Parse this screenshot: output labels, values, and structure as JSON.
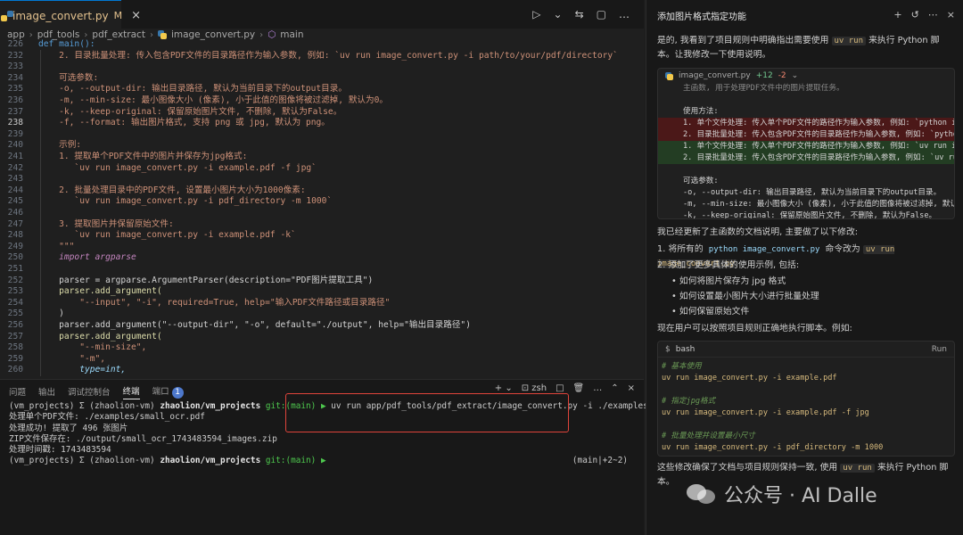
{
  "editor": {
    "tab": {
      "label": "image_convert.py",
      "modified": "M",
      "close": "×"
    },
    "actions": [
      "▷",
      "⌄",
      "⇆",
      "▢",
      "…"
    ],
    "breadcrumb": [
      "app",
      "pdf_tools",
      "pdf_extract",
      "image_convert.py",
      "main"
    ],
    "lines": [
      {
        "n": "226",
        "text": "def main():",
        "kind": "def"
      },
      {
        "n": "232",
        "text": "    2. 目录批量处理: 传入包含PDF文件的目录路径作为输入参数, 例如: `uv run image_convert.py -i path/to/your/pdf/directory`",
        "kind": "doc"
      },
      {
        "n": "233",
        "text": "",
        "kind": "doc"
      },
      {
        "n": "234",
        "text": "    可选参数:",
        "kind": "doc"
      },
      {
        "n": "235",
        "text": "    -o, --output-dir: 输出目录路径, 默认为当前目录下的output目录。",
        "kind": "doc"
      },
      {
        "n": "236",
        "text": "    -m, --min-size: 最小图像大小 (像素), 小于此值的图像将被过滤掉, 默认为0。",
        "kind": "doc"
      },
      {
        "n": "237",
        "text": "    -k, --keep-original: 保留原始图片文件, 不删除, 默认为False。",
        "kind": "doc"
      },
      {
        "n": "238",
        "text": "    -f, --format: 输出图片格式, 支持 png 或 jpg, 默认为 png。",
        "kind": "doc",
        "active": true
      },
      {
        "n": "239",
        "text": "",
        "kind": "doc"
      },
      {
        "n": "240",
        "text": "    示例:",
        "kind": "doc"
      },
      {
        "n": "241",
        "text": "    1. 提取单个PDF文件中的图片并保存为jpg格式:",
        "kind": "doc"
      },
      {
        "n": "242",
        "text": "       `uv run image_convert.py -i example.pdf -f jpg`",
        "kind": "doc"
      },
      {
        "n": "243",
        "text": "",
        "kind": "doc"
      },
      {
        "n": "244",
        "text": "    2. 批量处理目录中的PDF文件, 设置最小图片大小为1000像素:",
        "kind": "doc"
      },
      {
        "n": "245",
        "text": "       `uv run image_convert.py -i pdf_directory -m 1000`",
        "kind": "doc"
      },
      {
        "n": "246",
        "text": "",
        "kind": "doc"
      },
      {
        "n": "247",
        "text": "    3. 提取图片并保留原始文件:",
        "kind": "doc"
      },
      {
        "n": "248",
        "text": "       `uv run image_convert.py -i example.pdf -k`",
        "kind": "doc"
      },
      {
        "n": "249",
        "text": "    \"\"\"",
        "kind": "doc"
      },
      {
        "n": "250",
        "text": "    import argparse",
        "kind": "import"
      },
      {
        "n": "251",
        "text": "",
        "kind": "plain"
      },
      {
        "n": "252",
        "text": "    parser = argparse.ArgumentParser(description=\"PDF图片提取工具\")",
        "kind": "parser"
      },
      {
        "n": "253",
        "text": "    parser.add_argument(",
        "kind": "call"
      },
      {
        "n": "254",
        "text": "        \"--input\", \"-i\", required=True, help=\"输入PDF文件路径或目录路径\"",
        "kind": "args1"
      },
      {
        "n": "255",
        "text": "    )",
        "kind": "plain"
      },
      {
        "n": "256",
        "text": "    parser.add_argument(\"--output-dir\", \"-o\", default=\"./output\", help=\"输出目录路径\")",
        "kind": "args2"
      },
      {
        "n": "257",
        "text": "    parser.add_argument(",
        "kind": "call"
      },
      {
        "n": "258",
        "text": "        \"--min-size\",",
        "kind": "strline"
      },
      {
        "n": "259",
        "text": "        \"-m\",",
        "kind": "strline"
      },
      {
        "n": "260",
        "text": "        type=int,",
        "kind": "typeline"
      }
    ]
  },
  "panel": {
    "tabs": [
      "问题",
      "输出",
      "调试控制台",
      "终端",
      "端口"
    ],
    "active_tab": "终端",
    "port_badge": "1",
    "actions": [
      "+ ⌄",
      "zsh",
      "□",
      "🗑",
      "…",
      "⌃",
      "×"
    ],
    "terminal": [
      {
        "prompt": "(vm_projects) Σ (zhaolion-vm) ",
        "path": "zhaolion/vm_projects",
        "git": " git:(main) ▶ ",
        "cmd": "uv run app/pdf_tools/pdf_extract/image_convert.py -i ./examples/small_ocr.pdf"
      },
      {
        "out": "处理单个PDF文件: ./examples/small_ocr.pdf"
      },
      {
        "out": "处理成功! 提取了 496 张图片"
      },
      {
        "out": "ZIP文件保存在: ./output/small_ocr_1743483594_images.zip"
      },
      {
        "out": "处理时间戳: 1743483594"
      },
      {
        "prompt": "(vm_projects) Σ (zhaolion-vm) ",
        "path": "zhaolion/vm_projects",
        "git": " git:(main) ▶ ",
        "cmd": "",
        "right": "(main|+2~2)"
      }
    ]
  },
  "chat": {
    "title": "添加图片格式指定功能",
    "header_actions": [
      "+",
      "↺",
      "⋯",
      "×"
    ],
    "intro_a": "是的, 我看到了项目规则中明确指出需要使用",
    "intro_chip": "uv run",
    "intro_b": "来执行 Python 脚本。让我修改一下使用说明。",
    "diff": {
      "file": "image_convert.py",
      "plus": "+12",
      "minus": "-2",
      "lines": [
        {
          "type": "faded",
          "text": "主函数, 用于处理PDF文件中的图片提取任务。"
        },
        {
          "type": "ctx",
          "text": ""
        },
        {
          "type": "ctx",
          "text": "使用方法:"
        },
        {
          "type": "del",
          "text": "1. 单个文件处理: 传入单个PDF文件的路径作为输入参数, 例如: `python image"
        },
        {
          "type": "del",
          "text": "2. 目录批量处理: 传入包含PDF文件的目录路径作为输入参数, 例如: `python"
        },
        {
          "type": "add",
          "text": "1. 单个文件处理: 传入单个PDF文件的路径作为输入参数, 例如: `uv run image"
        },
        {
          "type": "add",
          "text": "2. 目录批量处理: 传入包含PDF文件的目录路径作为输入参数, 例如: `uv run"
        },
        {
          "type": "ctx",
          "text": ""
        },
        {
          "type": "ctx",
          "text": "可选参数:"
        },
        {
          "type": "ctx",
          "text": "-o, --output-dir: 输出目录路径, 默认为当前目录下的output目录。"
        },
        {
          "type": "ctx",
          "text": "-m, --min-size: 最小图像大小 (像素), 小于此值的图像将被过滤掉, 默认为0"
        },
        {
          "type": "ctx",
          "text": "-k, --keep-original: 保留原始图片文件, 不删除, 默认为False。"
        },
        {
          "type": "faded",
          "text": "-f, --format: 输出图片格式, 支持 png 或 jpg, 默认为 png"
        }
      ]
    },
    "update_text": "我已经更新了主函数的文档说明, 主要做了以下修改:",
    "item1_a": "1. 将所有的",
    "item1_chip1": "python image_convert.py",
    "item1_b": "命令改为",
    "item1_chip2": "uv run image_convert.py",
    "item2": "2. 添加了更多具体的使用示例, 包括:",
    "bullets": [
      "如何将图片保存为 jpg 格式",
      "如何设置最小图片大小进行批量处理",
      "如何保留原始文件"
    ],
    "now_text": "现在用户可以按照项目规则正确地执行脚本。例如:",
    "bash": {
      "label": "bash",
      "run": "Run",
      "lines": [
        {
          "type": "comment",
          "text": "# 基本使用"
        },
        {
          "type": "cmd",
          "text": "uv run image_convert.py -i example.pdf"
        },
        {
          "type": "blank",
          "text": ""
        },
        {
          "type": "comment",
          "text": "# 指定jpg格式"
        },
        {
          "type": "cmd",
          "text": "uv run image_convert.py -i example.pdf -f jpg"
        },
        {
          "type": "blank",
          "text": ""
        },
        {
          "type": "comment",
          "text": "# 批量处理并设置最小尺寸"
        },
        {
          "type": "cmd",
          "text": "uv run image_convert.py -i pdf_directory -m 1000"
        }
      ]
    },
    "footer_a": "这些修改确保了文档与项目规则保持一致, 使用",
    "footer_chip": "uv run",
    "footer_b": "来执行 Python 脚本。"
  },
  "watermark": "公众号 · AI Dalle",
  "colors": {
    "accent": "#0078d4",
    "highlight_box": "#e0443b",
    "diff_add": "#233d23",
    "diff_del": "#4b1818"
  }
}
